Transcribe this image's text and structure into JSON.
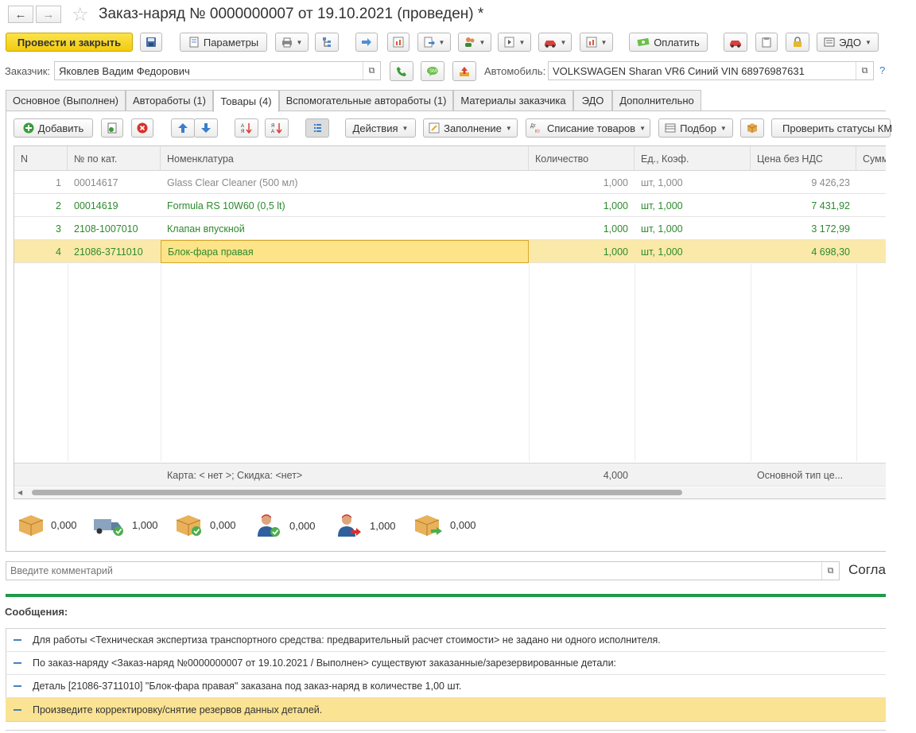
{
  "window": {
    "title": "Заказ-наряд № 0000000007  от 19.10.2021 (проведен) *",
    "back_glyph": "←",
    "forward_glyph": "→",
    "star_glyph": "☆"
  },
  "toolbar": {
    "post_close": "Провести и закрыть",
    "params": "Параметры",
    "pay": "Оплатить",
    "edo": "ЭДО"
  },
  "header": {
    "customer_label": "Заказчик:",
    "customer_value": "Яковлев Вадим Федорович",
    "car_label": "Автомобиль:",
    "car_value": "VOLKSWAGEN Sharan VR6 Синий VIN 68976987631",
    "help": "?"
  },
  "tabs": [
    {
      "label": "Основное (Выполнен)"
    },
    {
      "label": "Автоработы (1)"
    },
    {
      "label": "Товары (4)"
    },
    {
      "label": "Вспомогательные автоработы (1)"
    },
    {
      "label": "Материалы заказчика"
    },
    {
      "label": "ЭДО"
    },
    {
      "label": "Дополнительно"
    }
  ],
  "grid_toolbar": {
    "add": "Добавить",
    "actions": "Действия",
    "fill": "Заполнение",
    "writeoff": "Списание товаров",
    "pick": "Подбор",
    "check": "Проверить статусы КМ"
  },
  "table": {
    "columns": [
      "N",
      "№ по кат.",
      "Номенклатура",
      "Количество",
      "Ед., Коэф.",
      "Цена без НДС",
      "Сумма"
    ],
    "rows": [
      {
        "n": "1",
        "cat": "00014617",
        "name": "Glass Clear Cleaner (500 мл)",
        "qty": "1,000",
        "unit": "шт, 1,000",
        "price": "9 426,23"
      },
      {
        "n": "2",
        "cat": "00014619",
        "name": "Formula RS 10W60 (0,5 lt)",
        "qty": "1,000",
        "unit": "шт, 1,000",
        "price": "7 431,92"
      },
      {
        "n": "3",
        "cat": "2108-1007010",
        "name": "Клапан впускной",
        "qty": "1,000",
        "unit": "шт, 1,000",
        "price": "3 172,99"
      },
      {
        "n": "4",
        "cat": "21086-3711010",
        "name": "Блок-фара правая",
        "qty": "1,000",
        "unit": "шт, 1,000",
        "price": "4 698,30"
      }
    ],
    "footer": {
      "card": "Карта: < нет >; Скидка: <нет>",
      "qty_total": "4,000",
      "price_type": "Основной тип це..."
    }
  },
  "stats": [
    {
      "icon": "box-icon",
      "value": "0,000"
    },
    {
      "icon": "truck-check-icon",
      "value": "1,000"
    },
    {
      "icon": "box-check-icon",
      "value": "0,000"
    },
    {
      "icon": "person-check-icon",
      "value": "0,000"
    },
    {
      "icon": "person-arrow-icon",
      "value": "1,000"
    },
    {
      "icon": "box-arrow-icon",
      "value": "0,000"
    }
  ],
  "comment": {
    "placeholder": "Введите комментарий",
    "side_label": "Согла"
  },
  "messages": {
    "title": "Сообщения:",
    "items": [
      "Для работы <Техническая экспертиза транспортного средства: предварительный расчет стоимости> не задано ни одного исполнителя.",
      "По заказ-наряду <Заказ-наряд №0000000007  от 19.10.2021 / Выполнен> существуют заказанные/зарезервированные детали:",
      "Деталь [21086-3711010] \"Блок-фара правая\" заказана под заказ-наряд в количестве 1,00 шт.",
      "Произведите корректировку/снятие резервов данных деталей."
    ]
  },
  "colors": {
    "accent_yellow": "#f5d21b",
    "selected_row": "#fbe9a9",
    "green_text": "#2d8a2d",
    "divider_green": "#1f9a4a"
  }
}
